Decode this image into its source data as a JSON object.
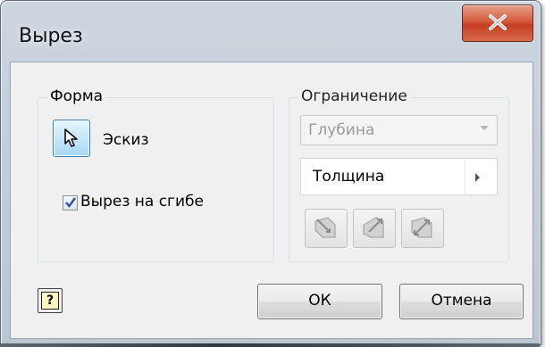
{
  "window": {
    "title": "Вырез"
  },
  "close_icon": "close-icon",
  "shape_group": {
    "label": "Форма",
    "sketch_label": "Эскиз",
    "sketch_icon": "cursor-arrow-icon",
    "cut_on_bend": {
      "label": "Вырез на сгибе",
      "checked": true
    }
  },
  "extent_group": {
    "label": "Ограничение",
    "depth_select": {
      "value": "Глубина",
      "enabled": false
    },
    "thickness_select": {
      "value": "Толщина"
    },
    "direction_buttons": [
      "direction-1-icon",
      "direction-2-icon",
      "direction-symmetric-icon"
    ]
  },
  "footer": {
    "help_icon": "help-icon",
    "help_label": "?",
    "ok_label": "ОК",
    "cancel_label": "Отмена"
  },
  "colors": {
    "title_bg": "#c5cfd9",
    "close_red": "#c43e22",
    "selection_blue": "#a6d6f3",
    "disabled_text": "#9a9a9a"
  }
}
